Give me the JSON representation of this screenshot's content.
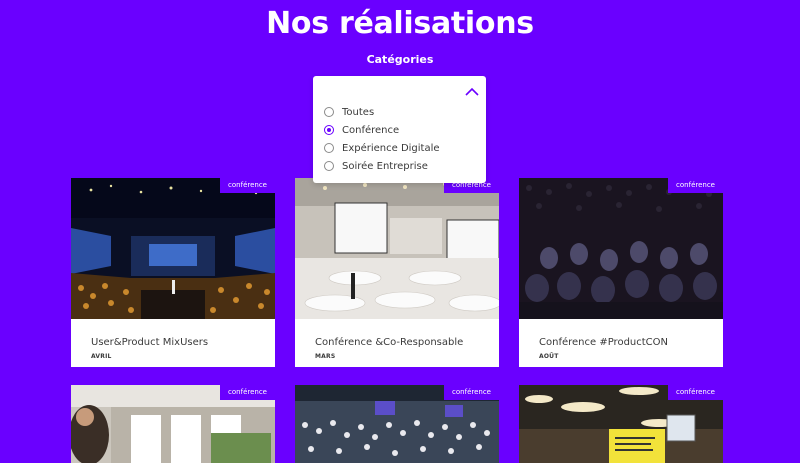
{
  "page": {
    "title": "Nos réalisations",
    "accent_color": "#6a00ff"
  },
  "filter": {
    "label": "Catégories",
    "options": [
      {
        "label": "Toutes",
        "selected": false
      },
      {
        "label": "Conférence",
        "selected": true
      },
      {
        "label": "Expérience Digitale",
        "selected": false
      },
      {
        "label": "Soirée Entreprise",
        "selected": false
      }
    ]
  },
  "projects": [
    {
      "badge": "conférence",
      "title": "User&Product MixUsers",
      "month": "AVRIL",
      "image": "auditorium-stage-photo"
    },
    {
      "badge": "conférence",
      "title": "Conférence &Co-Responsable",
      "month": "MARS",
      "image": "conference-room-photo"
    },
    {
      "badge": "conférence",
      "title": "Conférence #ProductCON",
      "month": "AOÛT",
      "image": "audience-dark-photo"
    },
    {
      "badge": "conférence",
      "image": "speaker-office-photo"
    },
    {
      "badge": "conférence",
      "image": "crowd-hall-photo"
    },
    {
      "badge": "conférence",
      "image": "coworking-space-photo"
    }
  ]
}
